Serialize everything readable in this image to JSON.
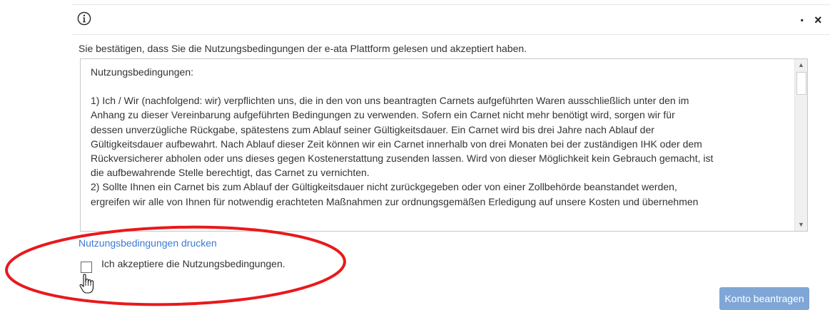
{
  "dialog": {
    "info_icon": "info-icon",
    "minimize_label": ".",
    "close_label": "×",
    "confirm_text": "Sie bestätigen, dass Sie die Nutzungsbedingungen der e-ata Plattform gelesen und akzeptiert haben."
  },
  "terms": {
    "heading": "Nutzungsbedingungen:",
    "lines": [
      "1) Ich / Wir (nachfolgend: wir) verpflichten uns, die in den von uns beantragten Carnets aufgeführten Waren ausschließlich unter den im",
      "Anhang zu dieser Vereinbarung aufgeführten Bedingungen zu verwenden. Sofern ein Carnet nicht mehr benötigt wird, sorgen wir für",
      "dessen unverzügliche Rückgabe, spätestens zum Ablauf seiner Gültigkeitsdauer. Ein Carnet wird bis drei Jahre nach Ablauf der",
      "Gültigkeitsdauer aufbewahrt. Nach Ablauf dieser Zeit können wir ein Carnet innerhalb von drei Monaten bei der zuständigen IHK oder dem",
      "Rückversicherer abholen oder uns dieses gegen Kostenerstattung zusenden lassen. Wird von dieser Möglichkeit kein Gebrauch gemacht, ist",
      "die aufbewahrende Stelle berechtigt, das Carnet zu vernichten.",
      "2) Sollte Ihnen ein Carnet bis zum Ablauf der Gültigkeitsdauer nicht zurückgegeben oder von einer Zollbehörde beanstandet werden,",
      "ergreifen wir alle von Ihnen für notwendig erachteten Maßnahmen zur ordnungsgemäßen Erledigung auf unsere Kosten und übernehmen"
    ]
  },
  "links": {
    "print": "Nutzungsbedingungen drucken"
  },
  "accept": {
    "label": "Ich akzeptiere die Nutzungsbedingungen.",
    "checked": false
  },
  "buttons": {
    "submit": "Konto beantragen"
  },
  "colors": {
    "link": "#3a7bd5",
    "button_disabled": "#7fa6d6",
    "highlight": "#e8191c"
  }
}
